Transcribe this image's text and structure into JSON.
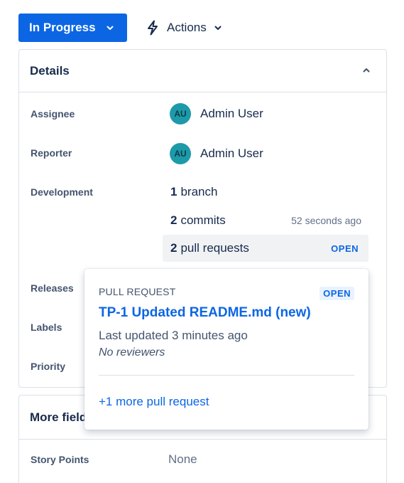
{
  "toolbar": {
    "status_label": "In Progress",
    "actions_label": "Actions"
  },
  "details": {
    "title": "Details",
    "assignee": {
      "label": "Assignee",
      "initials": "AU",
      "name": "Admin User"
    },
    "reporter": {
      "label": "Reporter",
      "initials": "AU",
      "name": "Admin User"
    },
    "development": {
      "label": "Development",
      "branch": {
        "count": "1",
        "text": "branch"
      },
      "commits": {
        "count": "2",
        "text": "commits",
        "time": "52 seconds ago"
      },
      "pull_requests": {
        "count": "2",
        "text": "pull requests",
        "status": "OPEN"
      }
    },
    "releases_label": "Releases",
    "labels_label": "Labels",
    "priority_label": "Priority"
  },
  "more_fields": {
    "title": "More fields",
    "story_points": {
      "label": "Story Points",
      "value": "None"
    }
  },
  "popup": {
    "kicker": "PULL REQUEST",
    "status": "OPEN",
    "title": "TP-1 Updated README.md (new)",
    "updated": "Last updated 3 minutes ago",
    "reviewers": "No reviewers",
    "more_link": "+1 more pull request"
  },
  "colors": {
    "primary": "#0c66e4",
    "avatar": "#1d9aaa",
    "border": "#dcdfe4"
  }
}
